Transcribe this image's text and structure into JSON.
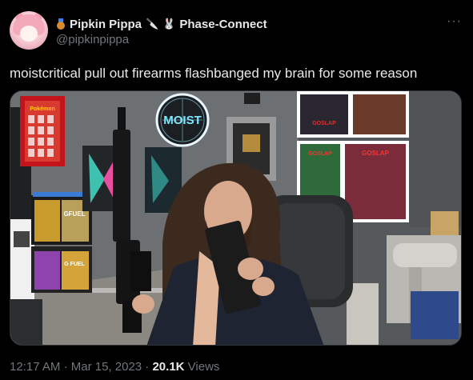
{
  "author": {
    "display_name": "Pipkin Pippa",
    "emoji_knife": "🔪",
    "emoji_bunny": "🐰",
    "affiliation": "Phase-Connect",
    "handle": "@pipkinpippa"
  },
  "more_label": "···",
  "tweet": {
    "text": "moistcritical pull out firearms flashbanged my brain for some reason"
  },
  "media": {
    "neon_sign": "MOIST",
    "poster_text_1": "GFUEL",
    "poster_text_2": "G FUEL",
    "comic_label_1": "GOSLAP",
    "comic_label_2": "GOSLAP",
    "comic_label_3": "GOSLAP"
  },
  "meta": {
    "time": "12:17 AM",
    "separator": "·",
    "date": "Mar 15, 2023",
    "views_count": "20.1K",
    "views_label": "Views"
  },
  "colors": {
    "background": "#000000",
    "text_primary": "#e7e9ea",
    "text_secondary": "#71767b",
    "border": "#2f3336"
  }
}
